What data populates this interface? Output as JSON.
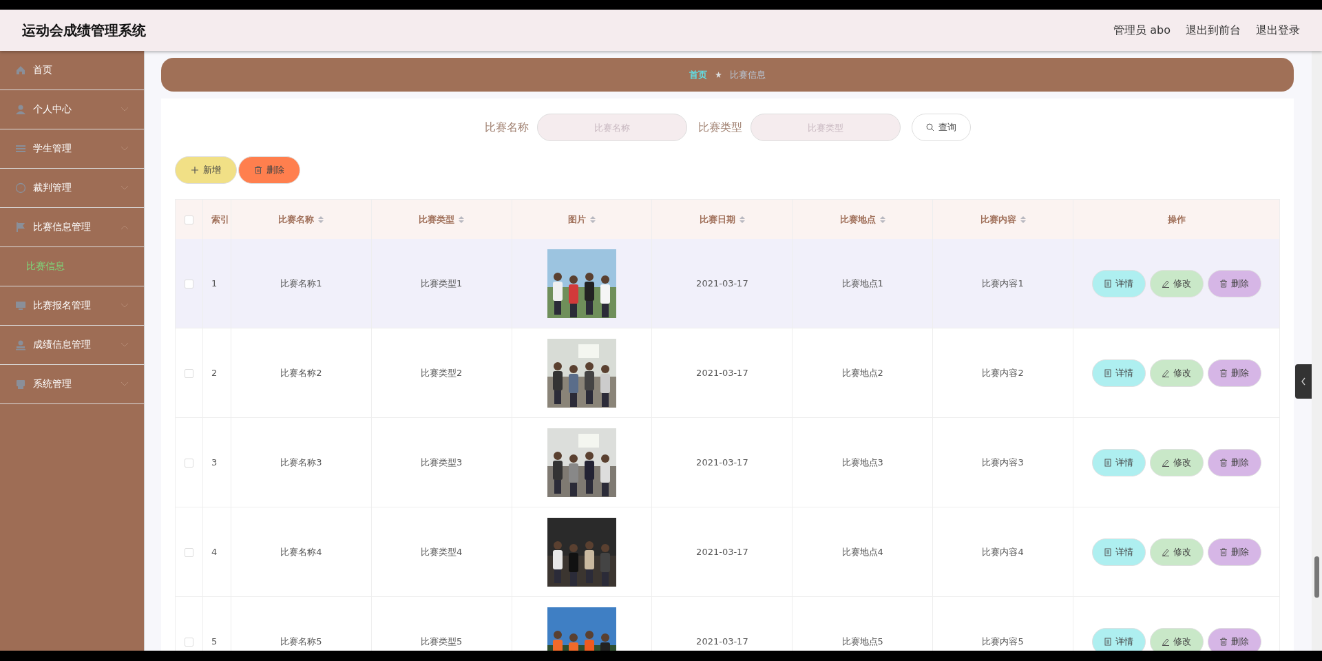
{
  "header": {
    "title": "运动会成绩管理系统",
    "user": "管理员 abo",
    "links": [
      "退出到前台",
      "退出登录"
    ]
  },
  "sidebar": {
    "items": [
      {
        "label": "首页",
        "has_arrow": false
      },
      {
        "label": "个人中心",
        "expanded": false,
        "has_arrow": true
      },
      {
        "label": "学生管理",
        "expanded": false,
        "has_arrow": true
      },
      {
        "label": "裁判管理",
        "expanded": false,
        "has_arrow": true
      },
      {
        "label": "比赛信息管理",
        "expanded": true,
        "has_arrow": true,
        "children": [
          {
            "label": "比赛信息",
            "selected": true
          }
        ]
      },
      {
        "label": "比赛报名管理",
        "expanded": false,
        "has_arrow": true
      },
      {
        "label": "成绩信息管理",
        "expanded": false,
        "has_arrow": true
      },
      {
        "label": "系统管理",
        "expanded": false,
        "has_arrow": true
      }
    ]
  },
  "breadcrumb": [
    "首页",
    "比赛信息"
  ],
  "search": {
    "fields": [
      {
        "label": "比赛名称",
        "placeholder": "比赛名称"
      },
      {
        "label": "比赛类型",
        "placeholder": "比赛类型"
      }
    ],
    "button": "查询"
  },
  "actions": [
    {
      "kind": "add",
      "label": "新增"
    },
    {
      "kind": "delete",
      "label": "删除"
    }
  ],
  "table": {
    "select_all": {
      "checked": false
    },
    "columns": [
      {
        "label": "索引",
        "sortable": false
      },
      {
        "label": "比赛名称",
        "sortable": true
      },
      {
        "label": "比赛类型",
        "sortable": true
      },
      {
        "label": "图片",
        "sortable": true
      },
      {
        "label": "比赛日期",
        "sortable": true
      },
      {
        "label": "比赛地点",
        "sortable": true
      },
      {
        "label": "比赛内容",
        "sortable": true
      },
      {
        "label": "操作",
        "sortable": false
      }
    ],
    "rows": [
      {
        "checked": false,
        "hovered": true,
        "index": "1",
        "name": "比赛名称1",
        "type": "比赛类型1",
        "date": "2021-03-17",
        "place": "比赛地点1",
        "content": "比赛内容1",
        "actions": [
          {
            "kind": "detail",
            "label": "详情"
          },
          {
            "kind": "edit",
            "label": "修改"
          },
          {
            "kind": "delete",
            "label": "删除"
          }
        ]
      },
      {
        "checked": false,
        "hovered": false,
        "index": "2",
        "name": "比赛名称2",
        "type": "比赛类型2",
        "date": "2021-03-17",
        "place": "比赛地点2",
        "content": "比赛内容2",
        "actions": [
          {
            "kind": "detail",
            "label": "详情"
          },
          {
            "kind": "edit",
            "label": "修改"
          },
          {
            "kind": "delete",
            "label": "删除"
          }
        ]
      },
      {
        "checked": false,
        "hovered": false,
        "index": "3",
        "name": "比赛名称3",
        "type": "比赛类型3",
        "date": "2021-03-17",
        "place": "比赛地点3",
        "content": "比赛内容3",
        "actions": [
          {
            "kind": "detail",
            "label": "详情"
          },
          {
            "kind": "edit",
            "label": "修改"
          },
          {
            "kind": "delete",
            "label": "删除"
          }
        ]
      },
      {
        "checked": false,
        "hovered": false,
        "index": "4",
        "name": "比赛名称4",
        "type": "比赛类型4",
        "date": "2021-03-17",
        "place": "比赛地点4",
        "content": "比赛内容4",
        "actions": [
          {
            "kind": "detail",
            "label": "详情"
          },
          {
            "kind": "edit",
            "label": "修改"
          },
          {
            "kind": "delete",
            "label": "删除"
          }
        ]
      },
      {
        "checked": false,
        "hovered": false,
        "index": "5",
        "name": "比赛名称5",
        "type": "比赛类型5",
        "date": "2021-03-17",
        "place": "比赛地点5",
        "content": "比赛内容5",
        "actions": [
          {
            "kind": "detail",
            "label": "详情"
          },
          {
            "kind": "edit",
            "label": "修改"
          },
          {
            "kind": "delete",
            "label": "删除"
          }
        ]
      }
    ]
  }
}
